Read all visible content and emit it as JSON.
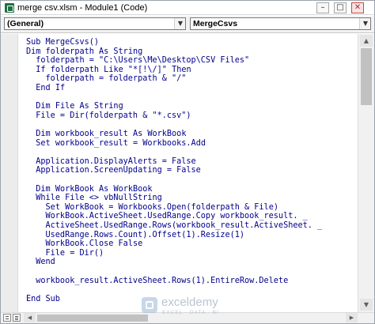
{
  "window": {
    "title": "merge csv.xlsm - Module1 (Code)",
    "buttons": {
      "minimize_icon": "minimize-icon",
      "maximize_icon": "maximize-icon",
      "close_icon": "close-icon"
    }
  },
  "toolbar": {
    "object_combo": "(General)",
    "procedure_combo": "MergeCsvs"
  },
  "colors": {
    "keyword": "#00008b",
    "string": "#00008b",
    "text": "#000000",
    "margin": "#ececec"
  },
  "code": {
    "lines": [
      [
        {
          "t": "Sub",
          "k": 1
        },
        {
          "t": " MergeCsvs()"
        }
      ],
      [
        {
          "t": "Dim",
          "k": 1
        },
        {
          "t": " folderpath "
        },
        {
          "t": "As String",
          "k": 1
        }
      ],
      [
        {
          "t": "  folderpath = \"C:\\Users\\Me\\Desktop\\CSV Files\""
        }
      ],
      [
        {
          "t": "  "
        },
        {
          "t": "If",
          "k": 1
        },
        {
          "t": " folderpath "
        },
        {
          "t": "Like",
          "k": 1
        },
        {
          "t": " \"*[!\\/]\" "
        },
        {
          "t": "Then",
          "k": 1
        }
      ],
      [
        {
          "t": "    folderpath = folderpath & \"/\""
        }
      ],
      [
        {
          "t": "  "
        },
        {
          "t": "End If",
          "k": 1
        }
      ],
      [
        {
          "t": ""
        }
      ],
      [
        {
          "t": "  "
        },
        {
          "t": "Dim",
          "k": 1
        },
        {
          "t": " File "
        },
        {
          "t": "As String",
          "k": 1
        }
      ],
      [
        {
          "t": "  File = Dir(folderpath & \"*.csv\")"
        }
      ],
      [
        {
          "t": ""
        }
      ],
      [
        {
          "t": "  "
        },
        {
          "t": "Dim",
          "k": 1
        },
        {
          "t": " workbook_result "
        },
        {
          "t": "As",
          "k": 1
        },
        {
          "t": " WorkBook"
        }
      ],
      [
        {
          "t": "  "
        },
        {
          "t": "Set",
          "k": 1
        },
        {
          "t": " workbook_result = Workbooks.Add"
        }
      ],
      [
        {
          "t": ""
        }
      ],
      [
        {
          "t": "  Application.DisplayAlerts = "
        },
        {
          "t": "False",
          "k": 1
        }
      ],
      [
        {
          "t": "  Application.ScreenUpdating = "
        },
        {
          "t": "False",
          "k": 1
        }
      ],
      [
        {
          "t": ""
        }
      ],
      [
        {
          "t": "  "
        },
        {
          "t": "Dim",
          "k": 1
        },
        {
          "t": " WorkBook "
        },
        {
          "t": "As",
          "k": 1
        },
        {
          "t": " WorkBook"
        }
      ],
      [
        {
          "t": "  "
        },
        {
          "t": "While",
          "k": 1
        },
        {
          "t": " File <> vbNullString"
        }
      ],
      [
        {
          "t": "    "
        },
        {
          "t": "Set",
          "k": 1
        },
        {
          "t": " WorkBook = Workbooks.Open(folderpath & File)"
        }
      ],
      [
        {
          "t": "    WorkBook.ActiveSheet.UsedRange.Copy workbook_result. _"
        }
      ],
      [
        {
          "t": "    ActiveSheet.UsedRange.Rows(workbook_result.ActiveSheet. _"
        }
      ],
      [
        {
          "t": "    UsedRange.Rows.Count).Offset(1).Resize(1)"
        }
      ],
      [
        {
          "t": "    WorkBook.Close "
        },
        {
          "t": "False",
          "k": 1
        }
      ],
      [
        {
          "t": "    File = Dir()"
        }
      ],
      [
        {
          "t": "  "
        },
        {
          "t": "Wend",
          "k": 1
        }
      ],
      [
        {
          "t": ""
        }
      ],
      [
        {
          "t": "  workbook_result.ActiveSheet.Rows(1).EntireRow.Delete"
        }
      ],
      [
        {
          "t": ""
        }
      ],
      [
        {
          "t": "End Sub",
          "k": 1
        }
      ]
    ]
  },
  "watermark": {
    "name": "exceldemy",
    "tagline": "EXCEL · DATA · BI"
  }
}
